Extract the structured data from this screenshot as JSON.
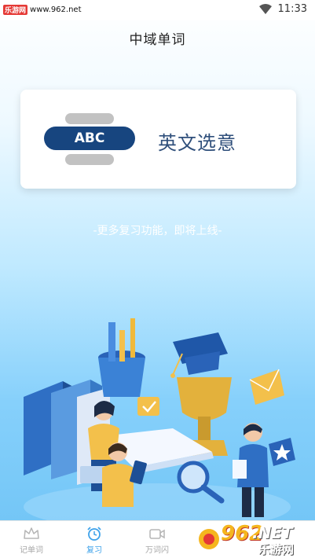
{
  "status_bar": {
    "watermark_logo": "乐游网",
    "watermark_url": "www.962.net",
    "time": "11:33"
  },
  "header": {
    "title": "中域单词"
  },
  "mode_card": {
    "icon_text": "ABC",
    "label": "英文选意"
  },
  "tip": "-更多复习功能，即将上线-",
  "tabbar": {
    "tabs": [
      {
        "label": "记单词",
        "icon": "crown-icon",
        "active": false
      },
      {
        "label": "复习",
        "icon": "alarm-clock-icon",
        "active": true
      },
      {
        "label": "万词闪",
        "icon": "video-icon",
        "active": false
      }
    ]
  },
  "watermark_badge": {
    "number": "962",
    ".net": ".NET",
    "cn": "乐游网"
  },
  "colors": {
    "accent": "#3ea2ea",
    "abc_pill": "#17457f",
    "card_label": "#2f4f7b"
  }
}
